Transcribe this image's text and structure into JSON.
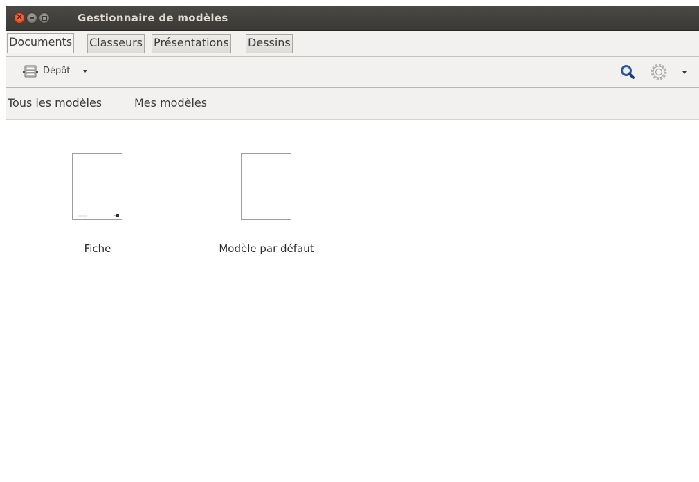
{
  "window": {
    "title": "Gestionnaire de modèles"
  },
  "tabs": [
    {
      "label": "Documents",
      "active": true
    },
    {
      "label": "Classeurs",
      "active": false
    },
    {
      "label": "Présentations",
      "active": false
    },
    {
      "label": "Dessins",
      "active": false
    }
  ],
  "toolbar": {
    "repository_label": "Dépôt",
    "icons": {
      "repository": "repository-icon",
      "search": "search-icon",
      "action": "gear-icon"
    },
    "search_color": "#2c5aa0"
  },
  "filters": [
    {
      "label": "Tous les modèles"
    },
    {
      "label": "Mes modèles"
    }
  ],
  "templates": [
    {
      "name": "Fiche"
    },
    {
      "name": "Modèle par défaut"
    }
  ]
}
